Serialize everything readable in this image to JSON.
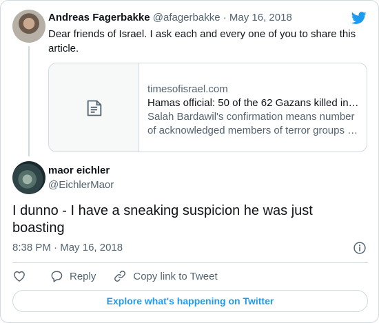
{
  "parent_tweet": {
    "author_name": "Andreas Fagerbakke",
    "handle": "@afagerbakke",
    "separator": "·",
    "date": "May 16, 2018",
    "text": "Dear friends of Israel. I ask each and every one of you to share this article.",
    "link_card": {
      "domain": "timesofisrael.com",
      "title": "Hamas official: 50 of the 62 Gazans killed in…",
      "description": "Salah Bardawil's confirmation means number of acknowledged members of terror groups …"
    }
  },
  "main_tweet": {
    "author_name": "maor eichler",
    "handle": "@EichlerMaor",
    "text": "I dunno - I have a sneaking suspicion he was just boasting",
    "time": "8:38 PM",
    "separator": "·",
    "date": "May 16, 2018"
  },
  "actions": {
    "reply_label": "Reply",
    "copy_label": "Copy link to Tweet"
  },
  "explore_label": "Explore what's happening on Twitter",
  "colors": {
    "accent": "#1d9bf0",
    "muted": "#536471",
    "border": "#cfd9de"
  },
  "icons": [
    "twitter-bird-icon",
    "document-icon",
    "info-icon",
    "heart-icon",
    "reply-icon",
    "link-icon"
  ]
}
